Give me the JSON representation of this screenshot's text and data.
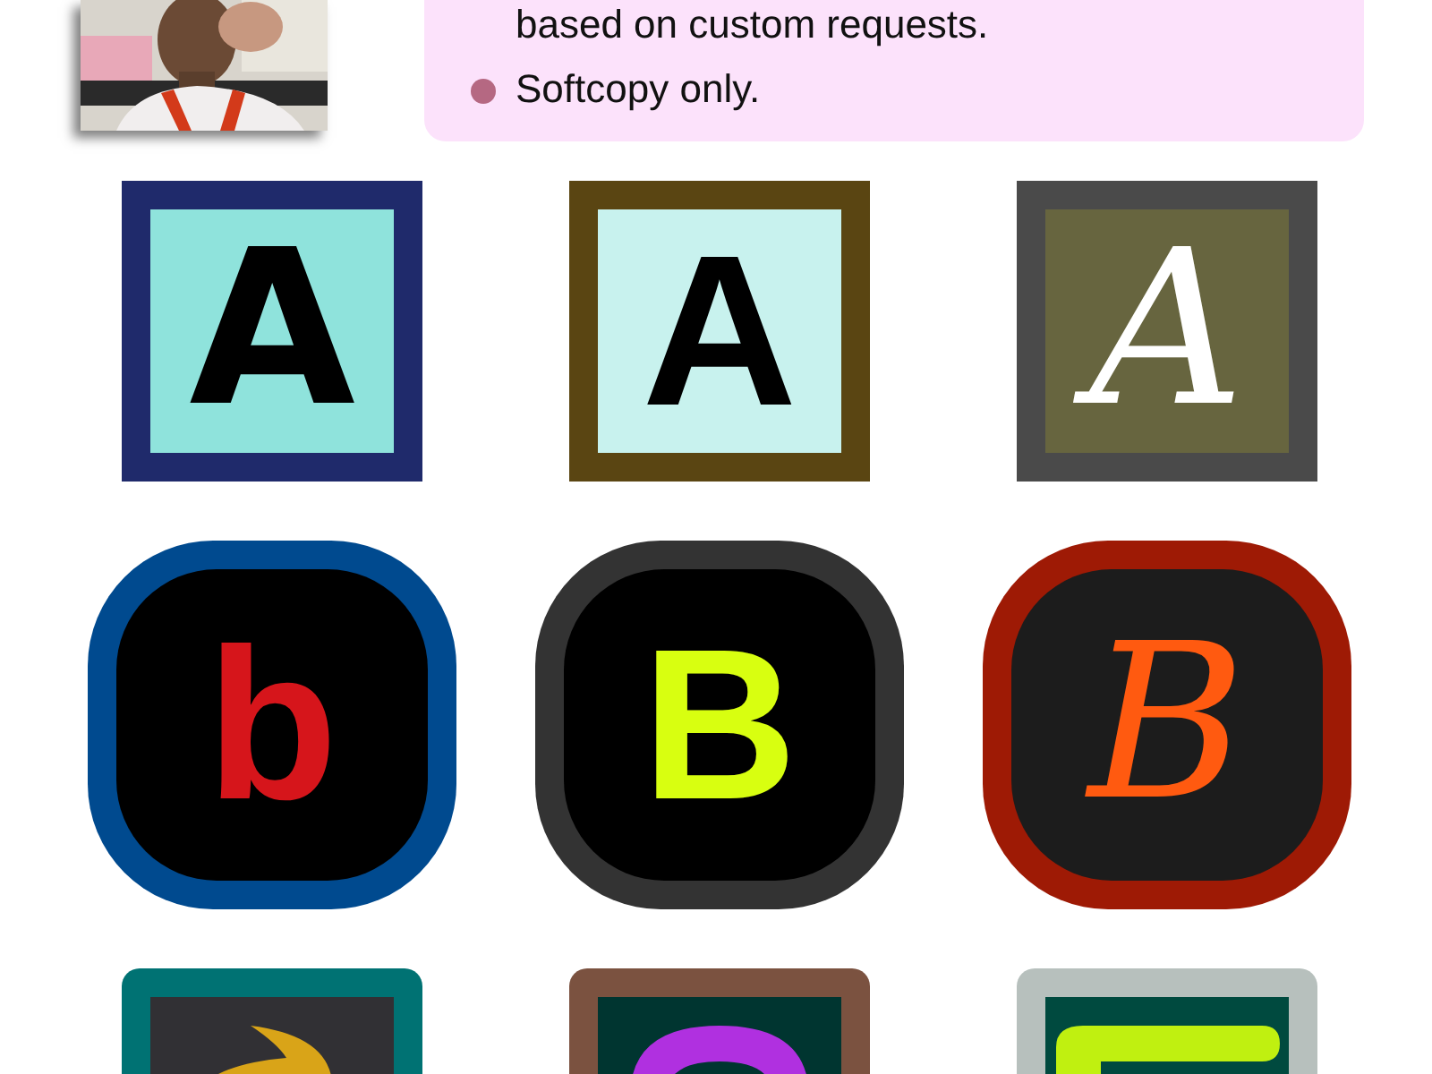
{
  "notes": [
    {
      "text": "based on custom requests.",
      "bullet": false
    },
    {
      "text": "Softcopy only.",
      "bullet": true
    }
  ],
  "logo_rows": [
    {
      "tiles": [
        {
          "letter": "A"
        },
        {
          "letter": "A"
        },
        {
          "letter": "A"
        }
      ]
    },
    {
      "tiles": [
        {
          "letter": "b"
        },
        {
          "letter": "B"
        },
        {
          "letter": "B"
        }
      ]
    },
    {
      "tiles": [
        {
          "kind": "mark"
        },
        {
          "kind": "mark"
        },
        {
          "kind": "mark"
        }
      ]
    }
  ]
}
